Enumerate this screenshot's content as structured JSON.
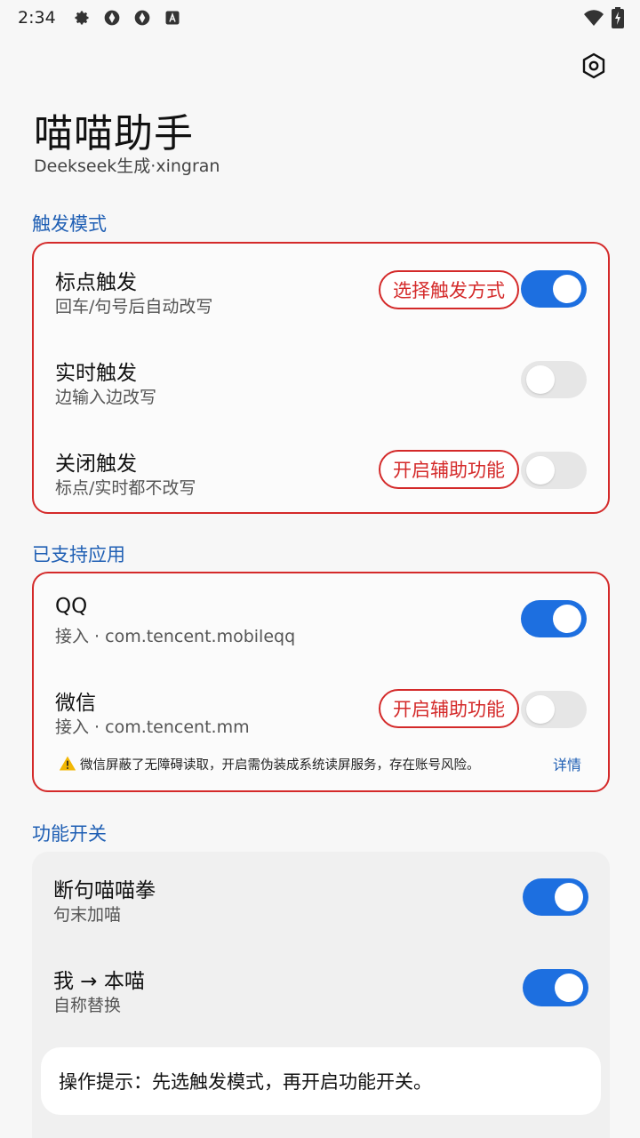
{
  "status_bar": {
    "time": "2:34",
    "icons_left": [
      "gear-icon",
      "aperture-icon",
      "aperture-icon",
      "font-icon"
    ],
    "icons_right": [
      "wifi-icon",
      "battery-charging-icon"
    ]
  },
  "header": {
    "title": "喵喵助手",
    "subtitle": "Deekseek生成·xingran",
    "settings_icon": "settings-hex-icon"
  },
  "trigger_section": {
    "title": "触发模式",
    "rows": [
      {
        "title": "标点触发",
        "subtitle": "回车/句号后自动改写",
        "toggle_on": true,
        "action_label": "选择触发方式"
      },
      {
        "title": "实时触发",
        "subtitle": "边输入边改写",
        "toggle_on": false
      },
      {
        "title": "关闭触发",
        "subtitle": "标点/实时都不改写",
        "toggle_on": false,
        "action_label": "开启辅助功能"
      }
    ]
  },
  "apps_section": {
    "title": "已支持应用",
    "rows": [
      {
        "title": "QQ",
        "subtitle": "接入 · com.tencent.mobileqq",
        "toggle_on": true
      },
      {
        "title": "微信",
        "subtitle": "接入 · com.tencent.mm",
        "toggle_on": false,
        "action_label": "开启辅助功能"
      }
    ],
    "warning": "微信屏蔽了无障碍读取，开启需伪装成系统读屏服务，存在账号风险。",
    "details_label": "详情"
  },
  "features_section": {
    "title": "功能开关",
    "rows": [
      {
        "title": "断句喵喵拳",
        "subtitle": "句末加喵",
        "toggle_on": true
      },
      {
        "title": "我 → 本喵",
        "subtitle": "自称替换",
        "toggle_on": true
      }
    ],
    "tip": "操作提示：先选触发模式，再开启功能开关。"
  },
  "colors": {
    "accent_blue": "#1d6fe0",
    "section_blue": "#1f5fb4",
    "highlight_red": "#d42a2a"
  }
}
